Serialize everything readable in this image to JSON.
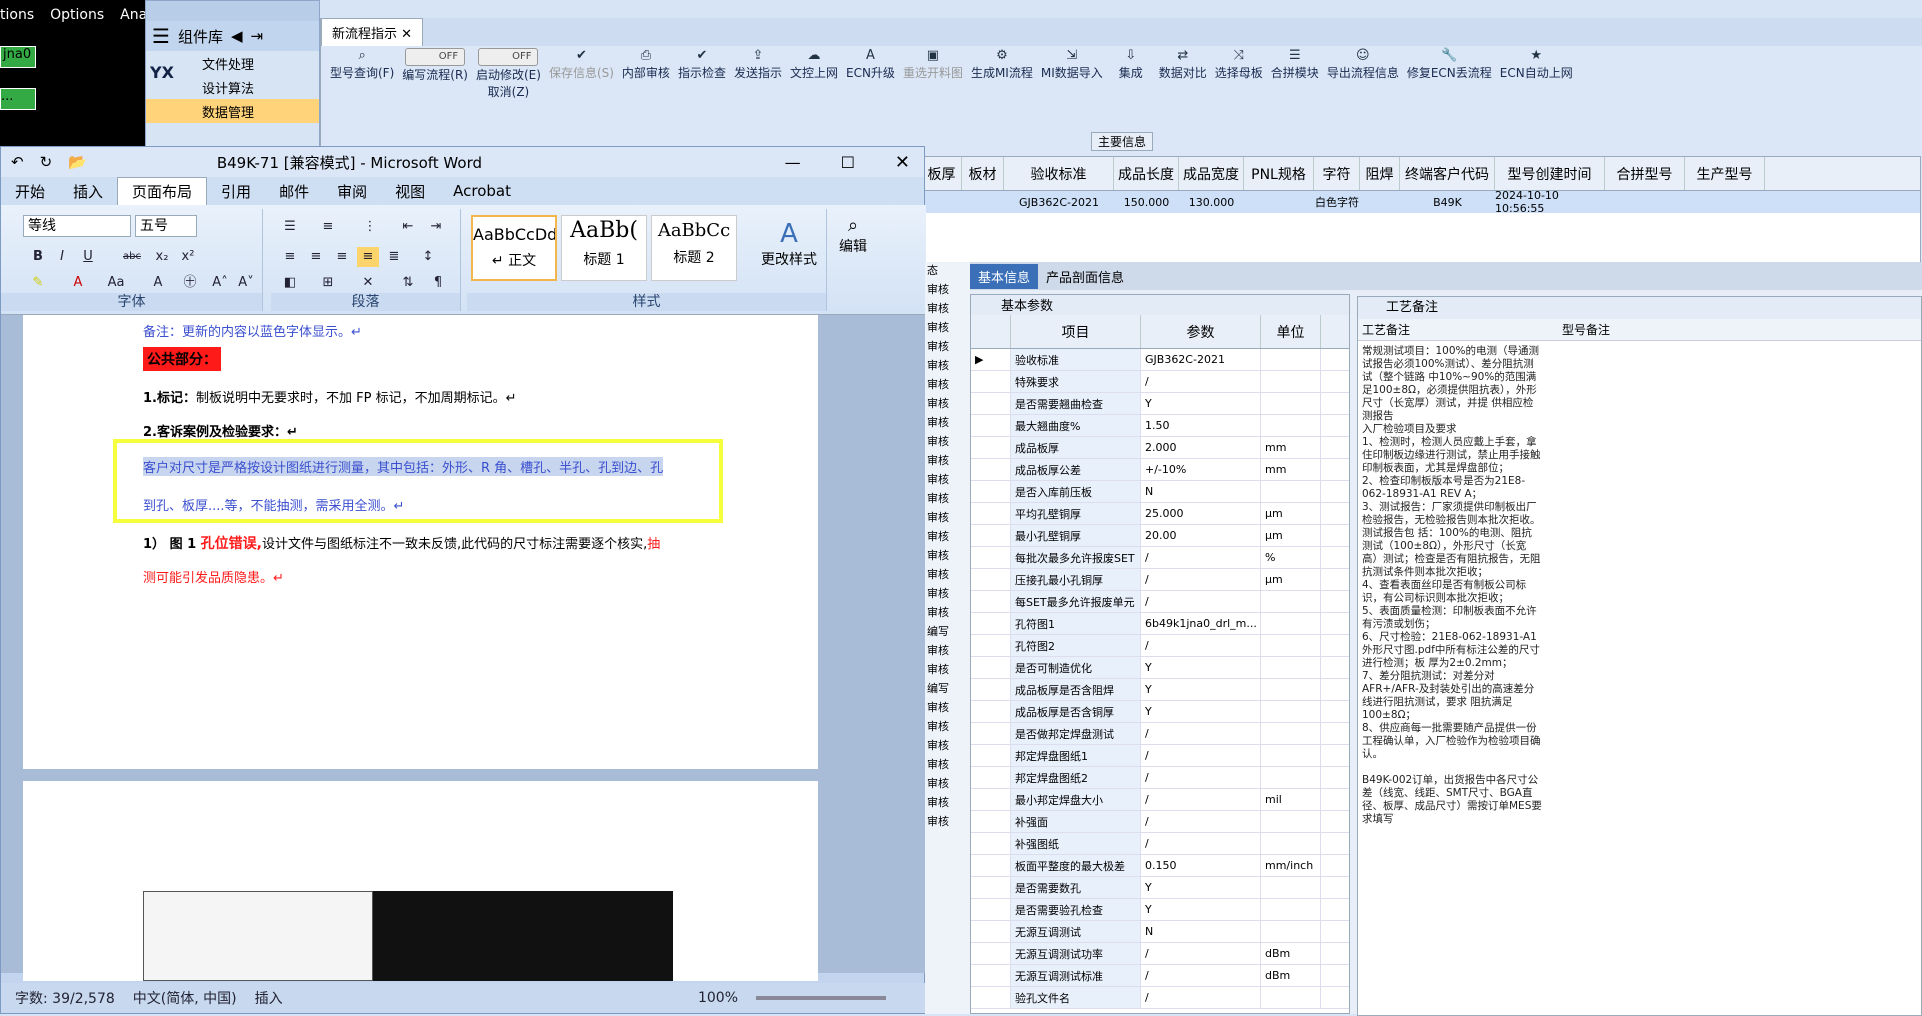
{
  "legacy": {
    "menu": [
      "tions",
      "Options",
      "Anal"
    ],
    "box1": "jna0",
    "box2": "..."
  },
  "complib": {
    "title": "组件库",
    "items": [
      "文件处理",
      "设计算法",
      "数据管理"
    ]
  },
  "topapp": {
    "tab": "新流程指示",
    "tools": [
      {
        "icon": "search-icon",
        "label": "型号查询(F)"
      },
      {
        "icon": "toggle",
        "label": "编写流程(R)",
        "toggle": "OFF"
      },
      {
        "icon": "toggle",
        "label": "启动修改(E)",
        "sub": "取消(Z)",
        "toggle": "OFF"
      },
      {
        "icon": "check-icon",
        "label": "保存信息(S)",
        "disabled": true
      },
      {
        "icon": "print-icon",
        "label": "内部审核"
      },
      {
        "icon": "check-icon",
        "label": "指示检查"
      },
      {
        "icon": "upload-icon",
        "label": "发送指示"
      },
      {
        "icon": "cloud-icon",
        "label": "文控上网"
      },
      {
        "icon": "a-icon",
        "label": "ECN升级"
      },
      {
        "icon": "image-icon",
        "label": "重选开料图",
        "disabled": true
      },
      {
        "icon": "gear-icon",
        "label": "生成MI流程"
      },
      {
        "icon": "import-icon",
        "label": "MI数据导入"
      },
      {
        "icon": "download-icon",
        "label": "集成"
      },
      {
        "icon": "compare-icon",
        "label": "数据对比"
      },
      {
        "icon": "shuffle-icon",
        "label": "选择母板"
      },
      {
        "icon": "list-icon",
        "label": "合拼模块"
      },
      {
        "icon": "smile-icon",
        "label": "导出流程信息"
      },
      {
        "icon": "wrench-icon",
        "label": "修复ECN丢流程"
      },
      {
        "icon": "star-icon",
        "label": "ECN自动上网"
      }
    ],
    "main_label": "主要信息",
    "grid_headers": [
      "板厚",
      "板材",
      "验收标准",
      "成品长度",
      "成品宽度",
      "PNL规格",
      "字符",
      "阻焊",
      "终端客户代码",
      "型号创建时间",
      "合拼型号",
      "生产型号"
    ],
    "grid_row": [
      "",
      "",
      "GJB362C-2021",
      "150.000",
      "130.000",
      "",
      "白色字符",
      "",
      "B49K",
      "2024-10-10 10:56:55",
      "",
      ""
    ]
  },
  "word": {
    "title": "B49K-71 [兼容模式] - Microsoft Word",
    "tabs": [
      "开始",
      "插入",
      "页面布局",
      "引用",
      "邮件",
      "审阅",
      "视图",
      "Acrobat"
    ],
    "font": "等线",
    "size": "五号",
    "styles": [
      {
        "preview": "AaBbCcDdEe",
        "name": "↵ 正文"
      },
      {
        "preview": "AaBb(",
        "name": "标题 1"
      },
      {
        "preview": "AaBbCc",
        "name": "标题 2"
      }
    ],
    "change_styles": "更改样式",
    "edit": "编辑",
    "groups": [
      "字体",
      "段落",
      "样式"
    ],
    "doc": {
      "note": "备注：更新的内容以蓝色字体显示。↵",
      "public": "公共部分：",
      "l1_bold": "1.标记：",
      "l1": "制板说明中无要求时，不加 FP 标记，不加周期标记。↵",
      "l2": "2.客诉案例及检验要求：↵",
      "hl1": "客户对尺寸是严格按设计图纸进行测量，其中包括：外形、R 角、槽孔、半孔、孔到边、孔",
      "hl2": "到孔、板厚....等，不能抽测，需采用全测。↵",
      "l3a": "1） 图 1 ",
      "l3b": "孔位错误,",
      "l3c": "设计文件与图纸标注不一致未反馈,此代码的尺寸标注需要逐个核实,",
      "l3d": "抽",
      "l4": "测可能引发品质隐患。↵"
    },
    "status": {
      "words": "字数: 39/2,578",
      "lang": "中文(简体, 中国)",
      "mode": "插入",
      "zoom": "100%"
    }
  },
  "proj": {
    "tabs": [
      "基本信息",
      "产品剖面信息"
    ],
    "sub_tab": "基本参数",
    "headers": [
      "项目",
      "参数",
      "单位"
    ],
    "rows": [
      [
        "验收标准",
        "GJB362C-2021",
        ""
      ],
      [
        "特殊要求",
        "/",
        ""
      ],
      [
        "是否需要翘曲检查",
        "Y",
        ""
      ],
      [
        "最大翘曲度%",
        "1.50",
        ""
      ],
      [
        "成品板厚",
        "2.000",
        "mm"
      ],
      [
        "成品板厚公差",
        "+/-10%",
        "mm"
      ],
      [
        "是否入库前压板",
        "N",
        ""
      ],
      [
        "平均孔壁铜厚",
        "25.000",
        "μm"
      ],
      [
        "最小孔壁铜厚",
        "20.00",
        "μm"
      ],
      [
        "每批次最多允许报废SET",
        "/",
        "%"
      ],
      [
        "压接孔最小孔铜厚",
        "/",
        "μm"
      ],
      [
        "每SET最多允许报废单元",
        "/",
        ""
      ],
      [
        "孔符图1",
        "6b49k1jna0_drl_m...",
        ""
      ],
      [
        "孔符图2",
        "/",
        ""
      ],
      [
        "是否可制造优化",
        "Y",
        ""
      ],
      [
        "成品板厚是否含阻焊",
        "Y",
        ""
      ],
      [
        "成品板厚是否含铜厚",
        "Y",
        ""
      ],
      [
        "是否做邦定焊盘测试",
        "/",
        ""
      ],
      [
        "邦定焊盘图纸1",
        "/",
        ""
      ],
      [
        "邦定焊盘图纸2",
        "/",
        ""
      ],
      [
        "最小邦定焊盘大小",
        "/",
        "mil"
      ],
      [
        "补强面",
        "/",
        ""
      ],
      [
        "补强图纸",
        "/",
        ""
      ],
      [
        "板面平整度的最大极差",
        "0.150",
        "mm/inch"
      ],
      [
        "是否需要数孔",
        "Y",
        ""
      ],
      [
        "是否需要验孔检查",
        "Y",
        ""
      ],
      [
        "无源互调测试",
        "N",
        ""
      ],
      [
        "无源互调测试功率",
        "/",
        "dBm"
      ],
      [
        "无源互调测试标准",
        "/",
        "dBm"
      ],
      [
        "验孔文件名",
        "/",
        ""
      ]
    ],
    "craft_tab": "工艺备注",
    "craft_head": "工艺备注",
    "model_head": "型号备注",
    "craft_note": "常规测试项目：100%的电测（导通测试报告必须100%测试）、差分阻抗测试（整个链路 中10%~90%的范围满足100±8Ω，必须提供阻抗表），外形尺寸（长宽厚）测试，并提 供相应检测报告\n入厂检验项目及要求\n1、检测时，检测人员应戴上手套，拿住印制板边缘进行测试，禁止用手接触印制板表面，尤其是焊盘部位；\n2、检查印制板版本号是否为21E8-062-18931-A1 REV A；\n3、测试报告：厂家须提供印制板出厂检验报告，无检验报告则本批次拒收。测试报告包 括：100%的电测、阻抗测试（100±8Ω），外形尺寸（长宽高）测试；检查是否有阻抗报告，无阻抗测试条件则本批次拒收；\n4、查看表面丝印是否有制板公司标识，有公司标识则本批次拒收；          5、表面质量检测：印制板表面不允许有污渍或划伤；\n6、尺寸检验：21E8-062-18931-A1外形尺寸图.pdf中所有标注公差的尺寸进行检测；板 厚为2±0.2mm；\n7、差分阻抗测试：对差分对AFR+/AFR-及封装处引出的高速差分线进行阻抗测试，要求 阻抗满足100±8Ω；\n8、供应商每一批需要随产品提供一份工程确认单，入厂检验作为检验项目确认。\n\nB49K-002订单，出货报告中各尺寸公差（线宽、线距、SMT尺寸、BGA直径、板厚、成品尺寸）需按订单MES要求填写",
    "left_strip": [
      "态",
      "审核",
      "审核",
      "审核",
      "审核",
      "审核",
      "审核",
      "审核",
      "审核",
      "审核",
      "审核",
      "审核",
      "审核",
      "审核",
      "审核",
      "审核",
      "审核",
      "审核",
      "审核",
      "编写",
      "审核",
      "审核",
      "编写",
      "审核",
      "审核",
      "审核",
      "审核",
      "审核",
      "审核",
      "审核"
    ]
  },
  "colors": {
    "accent": "#3b6fb8",
    "highlight": "#f5ff3b",
    "red_label": "#ff1a1a",
    "blue_text": "#3b4fd0"
  }
}
